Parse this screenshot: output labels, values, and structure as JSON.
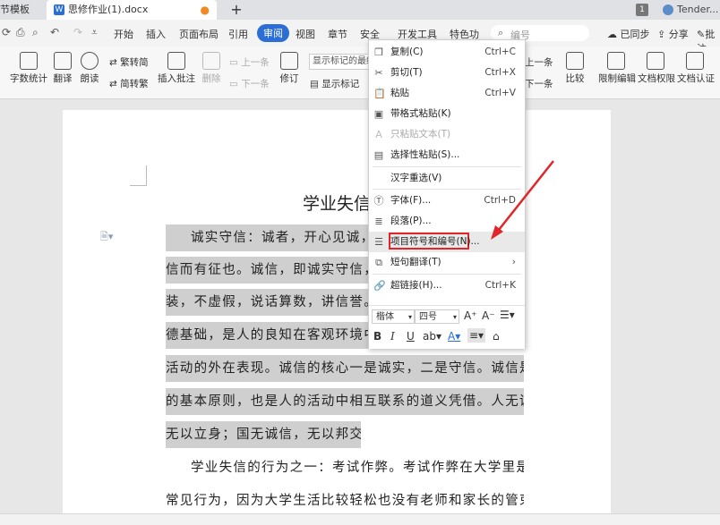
{
  "tabs": {
    "template_label": "节模板",
    "doc_label": "思修作业(1).docx",
    "doc_icon_letter": "W",
    "add_label": "+",
    "right_count": "1",
    "user_label": "Tender..."
  },
  "menu": {
    "items": [
      "开始",
      "插入",
      "页面布局",
      "引用",
      "审阅",
      "视图",
      "章节",
      "安全",
      "开发工具",
      "特色功"
    ],
    "active": "审阅",
    "search_placeholder": "编号",
    "sync_label": "已同步",
    "share_label": "分享",
    "comment_label": "批注"
  },
  "ribbon": {
    "word_count": "字数统计",
    "translate": "翻译",
    "read_aloud": "朗读",
    "trad_to_simp": "繁转简",
    "simp_to_trad": "简转繁",
    "insert_comment": "插入批注",
    "delete_comment": "删除",
    "prev_comment": "上一条",
    "next_comment": "下一条",
    "track_changes": "修订",
    "show_markup_dropdown": "显示标记的最终",
    "show_markup": "显示标记",
    "prev_change": "上一条",
    "next_change": "下一条",
    "compare": "比较",
    "restrict_edit": "限制编辑",
    "doc_permission": "文档权限",
    "doc_certify": "文档认证"
  },
  "document": {
    "title": "学业失信",
    "lines": [
      "诚实守信：诚者，开心见诚，无",
      "信而有征也。诚信，即诚实守信，是",
      "装，不虚假，说话算数，讲信誉。诚信是一个社会赖以存在的道",
      "德基础，是人的良知在客观环境中的",
      "活动的外在表现。诚信的核心一是诚实，二是守信。诚信是做人",
      "的基本原则，也是人的活动中相互联系的道义凭借。人无诚信，",
      "无以立身；国无诚信，无以邦交。",
      "学业失信的行为之一：考试作弊。考试作弊在大学里是一种",
      "常见行为，因为大学生活比较轻松也没有老师和家长的管束，同"
    ],
    "right_edge_chars": [
      "，",
      "是",
      "里"
    ]
  },
  "context_menu": {
    "copy": {
      "label": "复制(C)",
      "shortcut": "Ctrl+C"
    },
    "cut": {
      "label": "剪切(T)",
      "shortcut": "Ctrl+X"
    },
    "paste": {
      "label": "粘贴",
      "shortcut": "Ctrl+V"
    },
    "paste_format": {
      "label": "带格式粘贴(K)"
    },
    "paste_text": {
      "label": "只粘贴文本(T)"
    },
    "paste_special": {
      "label": "选择性粘贴(S)..."
    },
    "reconvert": {
      "label": "汉字重选(V)"
    },
    "font": {
      "label": "字体(F)...",
      "shortcut": "Ctrl+D"
    },
    "paragraph": {
      "label": "段落(P)..."
    },
    "bullets": {
      "label": "项目符号和编号(N)..."
    },
    "translate": {
      "label": "短句翻译(T)"
    },
    "hyperlink": {
      "label": "超链接(H)...",
      "shortcut": "Ctrl+K"
    },
    "font_name": "楷体",
    "font_size": "四号"
  },
  "colors": {
    "accent": "#2b6fd6",
    "highlight_box": "#e0262a",
    "arrow": "#e0262a",
    "selection": "#cfcfcf"
  }
}
